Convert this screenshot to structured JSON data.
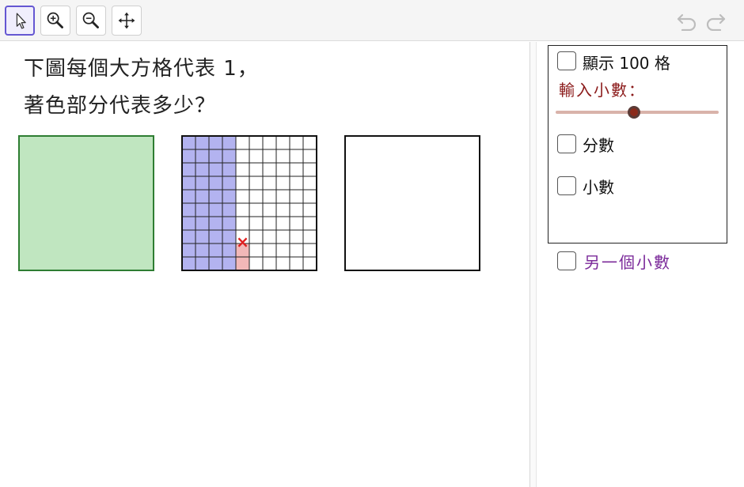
{
  "toolbar": {
    "tools": [
      {
        "name": "move-tool",
        "icon": "arrow-cursor-icon",
        "selected": true
      },
      {
        "name": "zoom-in-tool",
        "icon": "zoom-in-icon"
      },
      {
        "name": "zoom-out-tool",
        "icon": "zoom-out-icon"
      },
      {
        "name": "move-graphics-view-tool",
        "icon": "move-arrows-icon"
      }
    ],
    "undo_icon": "undo-icon",
    "redo_icon": "redo-icon"
  },
  "question": {
    "line1": "下圖每個大方格代表 1，",
    "line2": "著色部分代表多少？"
  },
  "figures": {
    "whole_fill": "#c0e6c0",
    "grid": {
      "rows": 10,
      "cols": 10,
      "shaded_full_columns": 4,
      "partial_column_cells": 2,
      "shaded_color": "#b3b3f0",
      "partial_color": "#f2b8b8",
      "marker": "×",
      "marker_color": "#e02020"
    }
  },
  "controls": {
    "show_100": {
      "label": "顯示 100 格",
      "checked": false
    },
    "slider": {
      "label": "輸入小數：",
      "value_fraction": 0.48
    },
    "fraction": {
      "label": "分數",
      "checked": false
    },
    "decimal": {
      "label": "小數",
      "checked": false
    },
    "another": {
      "label": "另一個小數",
      "checked": false
    }
  }
}
